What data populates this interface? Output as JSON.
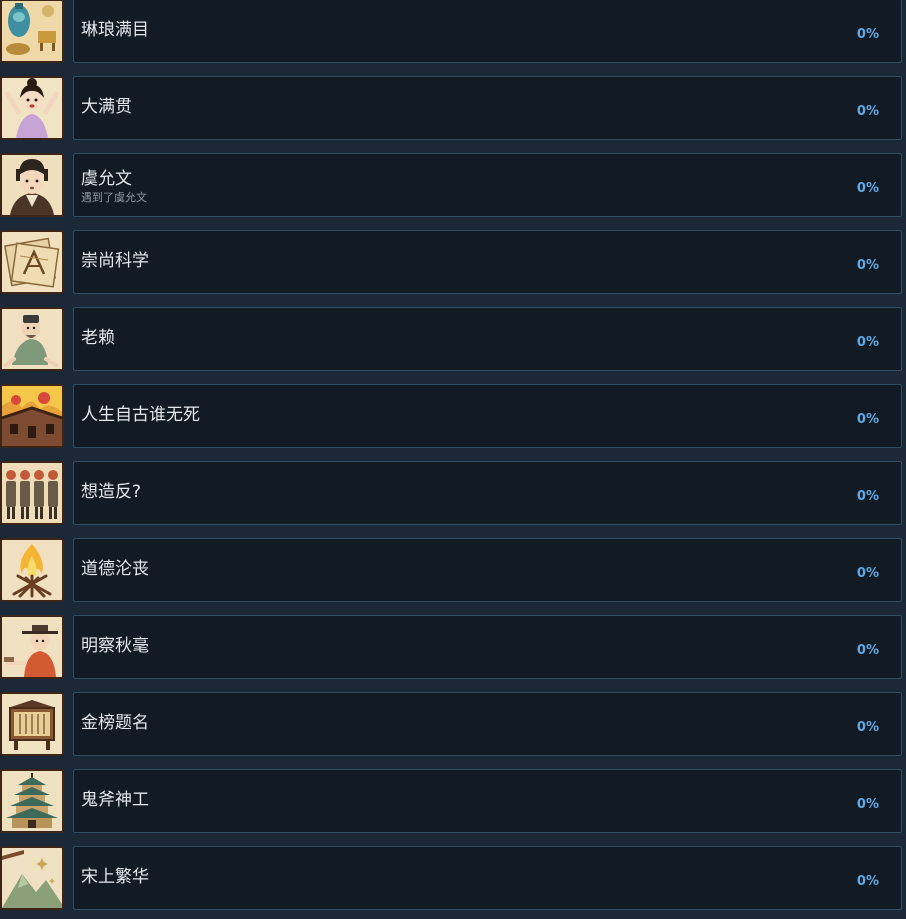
{
  "achievements": [
    {
      "title": "琳琅满目",
      "description": "",
      "percent": "0%",
      "icon": "antiques-icon"
    },
    {
      "title": "大满贯",
      "description": "",
      "percent": "0%",
      "icon": "cheering-lady-icon"
    },
    {
      "title": "虞允文",
      "description": "遇到了虞允文",
      "percent": "0%",
      "icon": "scholar-portrait-icon"
    },
    {
      "title": "崇尚科学",
      "description": "",
      "percent": "0%",
      "icon": "blueprint-icon"
    },
    {
      "title": "老赖",
      "description": "",
      "percent": "0%",
      "icon": "crawling-man-icon"
    },
    {
      "title": "人生自古谁无死",
      "description": "",
      "percent": "0%",
      "icon": "burning-house-icon"
    },
    {
      "title": "想造反?",
      "description": "",
      "percent": "0%",
      "icon": "soldiers-icon"
    },
    {
      "title": "道德沦丧",
      "description": "",
      "percent": "0%",
      "icon": "bonfire-icon"
    },
    {
      "title": "明察秋毫",
      "description": "",
      "percent": "0%",
      "icon": "official-at-desk-icon"
    },
    {
      "title": "金榜题名",
      "description": "",
      "percent": "0%",
      "icon": "exam-board-icon"
    },
    {
      "title": "鬼斧神工",
      "description": "",
      "percent": "0%",
      "icon": "pagoda-icon"
    },
    {
      "title": "宋上繁华",
      "description": "",
      "percent": "0%",
      "icon": "mountain-landscape-icon"
    }
  ],
  "colors": {
    "background": "#1b2838",
    "panel": "#121a24",
    "panel_border": "#2d4e63",
    "title_text": "#e4e8ed",
    "description_text": "#8f98a0",
    "percent_text": "#62a9e6"
  }
}
